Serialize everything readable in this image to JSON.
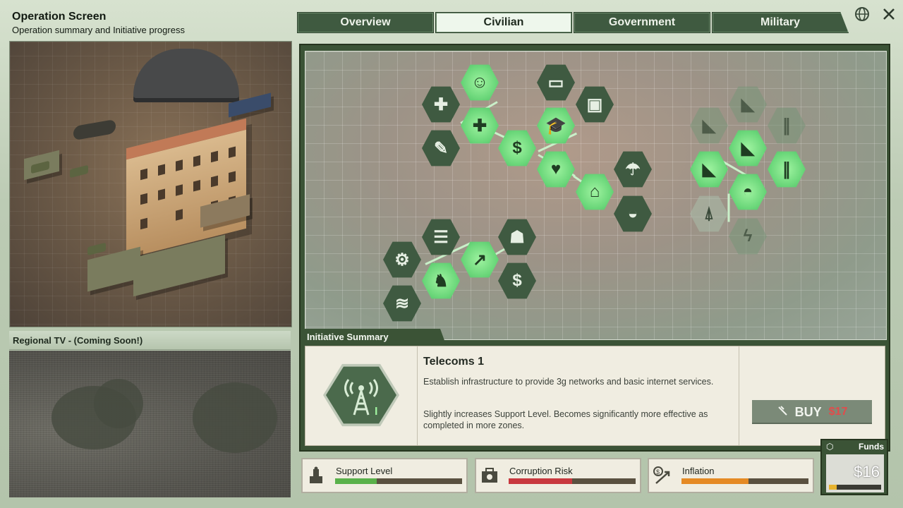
{
  "header": {
    "title": "Operation Screen",
    "subtitle": "Operation summary and Initiative progress"
  },
  "tabs": [
    {
      "label": "Overview",
      "active": false
    },
    {
      "label": "Civilian",
      "active": true
    },
    {
      "label": "Government",
      "active": false
    },
    {
      "label": "Military",
      "active": false
    }
  ],
  "top_icons": {
    "globe": "globe-icon",
    "close": "close-icon"
  },
  "tv": {
    "title": "Regional TV - (Coming Soon!)"
  },
  "summary": {
    "tab_label": "Initiative Summary",
    "name": "Telecoms 1",
    "description": "Establish infrastructure to provide 3g networks and basic internet services.",
    "effect": "Slightly increases Support Level. Becomes significantly more effective as completed in more zones.",
    "buy_label": "BUY",
    "buy_cost": "$17"
  },
  "stats": [
    {
      "label": "Support Level",
      "value": 0.33,
      "color": "#59b14a"
    },
    {
      "label": "Corruption Risk",
      "value": 0.5,
      "color": "#c8383e"
    },
    {
      "label": "Inflation",
      "value": 0.53,
      "color": "#e58a24"
    }
  ],
  "funds": {
    "label": "Funds",
    "value": "$16",
    "level": 0.15
  },
  "colors": {
    "accent": "#3b5336",
    "lit_node": "#6bd77a",
    "buy_cost": "#e24b4b"
  }
}
